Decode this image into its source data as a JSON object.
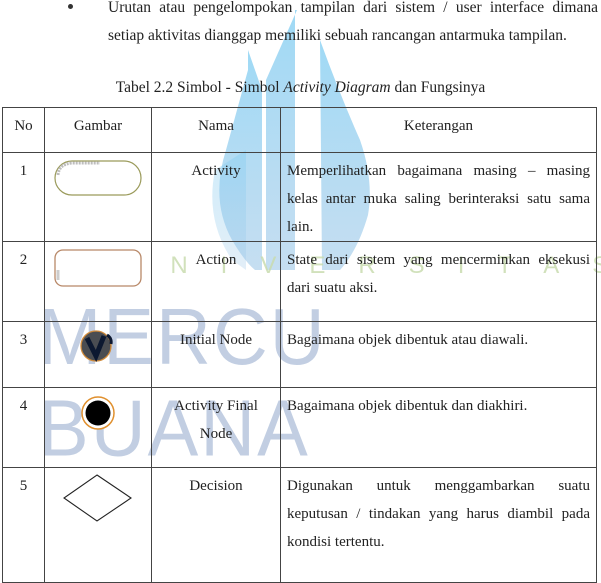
{
  "bullet": {
    "marker": "•",
    "text": "Urutan atau pengelompokan tampilan dari sistem / user interface dimana setiap aktivitas dianggap memiliki sebuah rancangan antarmuka tampilan."
  },
  "caption": {
    "prefix": "Tabel 2.2 Simbol - Simbol ",
    "italic": "Activity Diagram",
    "suffix": " dan Fungsinya"
  },
  "watermark": {
    "line1": "UNIVERSITAS",
    "line2": "MERCU BUANA",
    "logo_color": "#8fd0f0",
    "text_color_top": "#c9dcb0",
    "text_color_bottom": "#b3c3dc"
  },
  "table": {
    "headers": [
      "No",
      "Gambar",
      "Nama",
      "Keterangan"
    ],
    "rows": [
      {
        "no": "1",
        "icon": "activity-rounded-rectangle-icon",
        "name": "Activity",
        "description": "Memperlihatkan bagaimana masing – masing kelas antar muka saling berinteraksi satu sama lain."
      },
      {
        "no": "2",
        "icon": "action-rounded-rectangle-icon",
        "name": "Action",
        "description": "State dari sistem yang mencerminkan eksekusi dari suatu aksi."
      },
      {
        "no": "3",
        "icon": "initial-node-icon",
        "name": "Initial Node",
        "description": "Bagaimana objek dibentuk atau diawali."
      },
      {
        "no": "4",
        "icon": "activity-final-node-icon",
        "name": "Activity Final Node",
        "description": "Bagaimana objek dibentuk dan diakhiri."
      },
      {
        "no": "5",
        "icon": "decision-diamond-icon",
        "name": "Decision",
        "description": "Digunakan untuk menggambarkan suatu keputusan / tindakan yang harus diambil pada kondisi tertentu."
      }
    ]
  }
}
